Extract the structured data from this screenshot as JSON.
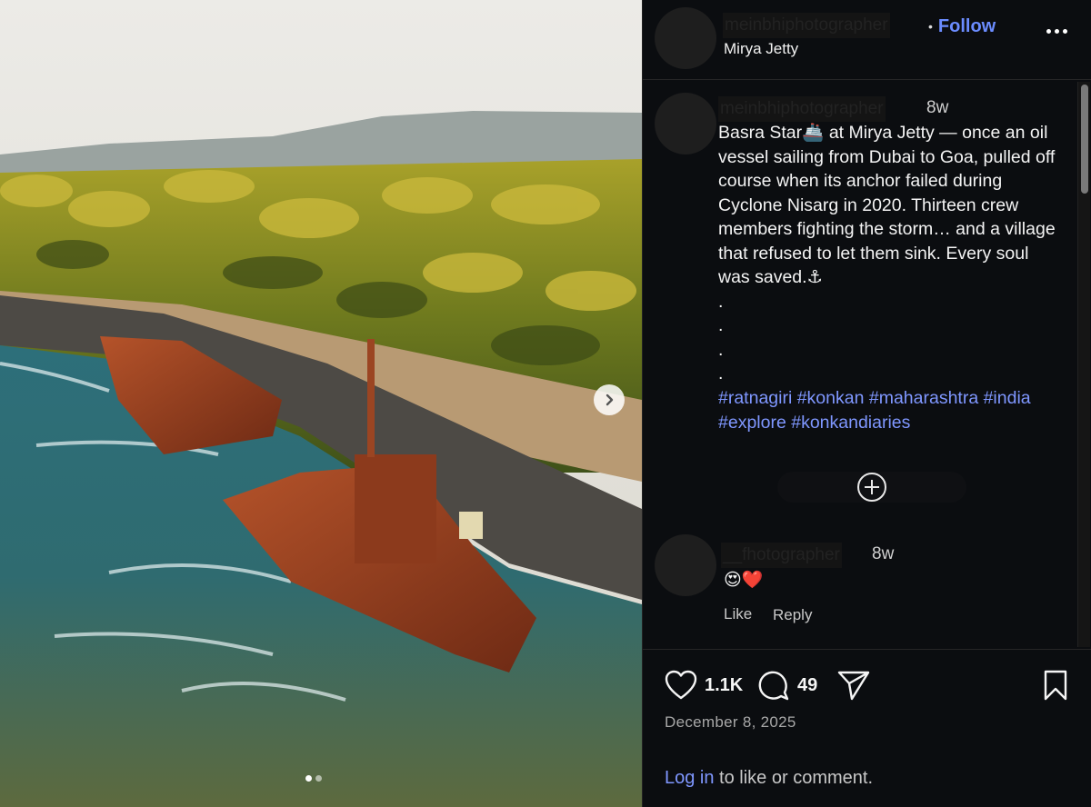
{
  "post": {
    "username": "meinbhiphotographer",
    "follow_label": "Follow",
    "location": "Mirya Jetty"
  },
  "caption": {
    "username": "meinbhiphotographer",
    "time": "8w",
    "text": "Basra Star🚢 at Mirya Jetty — once an oil vessel sailing from Dubai to Goa, pulled off course when its anchor failed during Cyclone Nisarg in 2020. Thirteen crew members fighting the storm… and a village that refused to let them sink. Every soul was saved.⚓\n.\n.\n.\n.",
    "hashtags": "#ratnagiri #konkan #maharashtra #india #explore #konkandiaries"
  },
  "comment": {
    "username": "__fhotographer",
    "time": "8w",
    "text": "😍❤️",
    "like_label": "Like",
    "reply_label": "Reply"
  },
  "stats": {
    "likes": "1.1K",
    "comments": "49",
    "date": "December 8, 2025"
  },
  "login": {
    "link": "Log in",
    "rest": " to like or comment."
  },
  "carousel": {
    "slide_count": 2,
    "current_slide": 1
  }
}
